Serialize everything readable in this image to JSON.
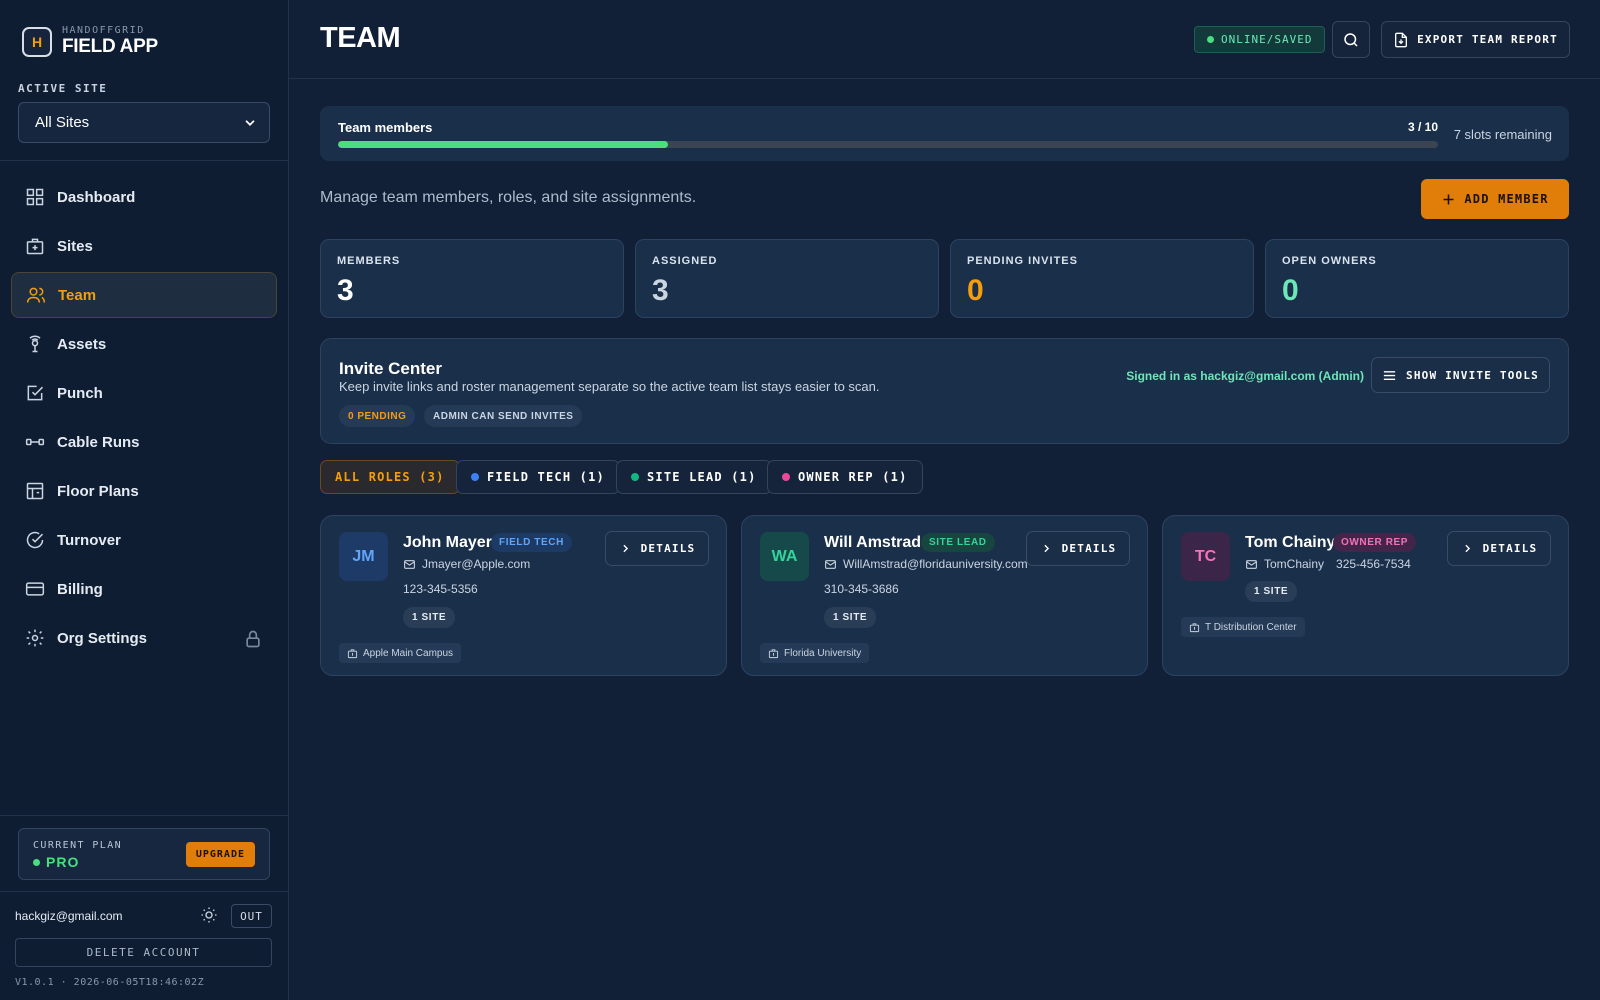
{
  "brand": {
    "subtitle": "HANDOFFGRID",
    "title": "FIELD APP",
    "logo_letter": "H"
  },
  "sidebar": {
    "site_label": "ACTIVE SITE",
    "site_value": "All Sites",
    "items": [
      {
        "label": "Dashboard",
        "icon": "grid-icon"
      },
      {
        "label": "Sites",
        "icon": "building-icon"
      },
      {
        "label": "Team",
        "icon": "users-icon",
        "active": true
      },
      {
        "label": "Assets",
        "icon": "radar-icon"
      },
      {
        "label": "Punch",
        "icon": "checkbox-icon"
      },
      {
        "label": "Cable Runs",
        "icon": "cable-icon"
      },
      {
        "label": "Floor Plans",
        "icon": "floorplan-icon"
      },
      {
        "label": "Turnover",
        "icon": "check-circle-icon"
      },
      {
        "label": "Billing",
        "icon": "card-icon"
      },
      {
        "label": "Org Settings",
        "icon": "gear-icon",
        "locked": true
      }
    ],
    "plan": {
      "label": "CURRENT PLAN",
      "value": "PRO",
      "upgrade": "UPGRADE"
    },
    "user_email": "hackgiz@gmail.com",
    "out_label": "OUT",
    "delete_label": "DELETE ACCOUNT",
    "version": "V1.0.1 · 2026-06-05T18:46:02Z"
  },
  "header": {
    "title": "TEAM",
    "status": "ONLINE/SAVED",
    "export_label": "EXPORT TEAM REPORT"
  },
  "progress": {
    "title": "Team members",
    "count": "3 / 10",
    "remaining": "7 slots remaining",
    "fraction": 0.3
  },
  "main": {
    "subtitle": "Manage team members, roles, and site assignments.",
    "add_label": "ADD MEMBER"
  },
  "stats": [
    {
      "label": "MEMBERS",
      "value": "3",
      "color": "#ffffff"
    },
    {
      "label": "ASSIGNED",
      "value": "3",
      "color": "#cbd5e1"
    },
    {
      "label": "PENDING INVITES",
      "value": "0",
      "color": "#f59e0b"
    },
    {
      "label": "OPEN OWNERS",
      "value": "0",
      "color": "#6ee7b7"
    }
  ],
  "invite": {
    "title": "Invite Center",
    "description": "Keep invite links and roster management separate so the active team list stays easier to scan.",
    "chip_pending": "0 PENDING",
    "chip_admin": "ADMIN CAN SEND INVITES",
    "signed_in": "Signed in as hackgiz@gmail.com (Admin)",
    "tools_label": "SHOW INVITE TOOLS"
  },
  "filters": [
    {
      "label": "ALL ROLES (3)",
      "active": true
    },
    {
      "label": "FIELD TECH (1)",
      "color": "#3b82f6"
    },
    {
      "label": "SITE LEAD (1)",
      "color": "#10b981"
    },
    {
      "label": "OWNER REP (1)",
      "color": "#ec4899"
    }
  ],
  "members": [
    {
      "initials": "JM",
      "name": "John Mayer",
      "role": "FIELD TECH",
      "role_color": "#60a5fa",
      "email": "Jmayer@Apple.com",
      "phone": "123-345-5356",
      "sites": "1 SITE",
      "site_name": "Apple Main Campus",
      "details": "DETAILS"
    },
    {
      "initials": "WA",
      "name": "Will Amstrad",
      "role": "SITE LEAD",
      "role_color": "#34d399",
      "email": "WillAmstrad@floridauniversity.com",
      "phone": "310-345-3686",
      "sites": "1 SITE",
      "site_name": "Florida University",
      "details": "DETAILS"
    },
    {
      "initials": "TC",
      "name": "Tom Chainy",
      "role": "OWNER REP",
      "role_color": "#f472b6",
      "email": "TomChainy",
      "phone": "325-456-7534",
      "sites": "1 SITE",
      "site_name": "T Distribution Center",
      "details": "DETAILS"
    }
  ]
}
